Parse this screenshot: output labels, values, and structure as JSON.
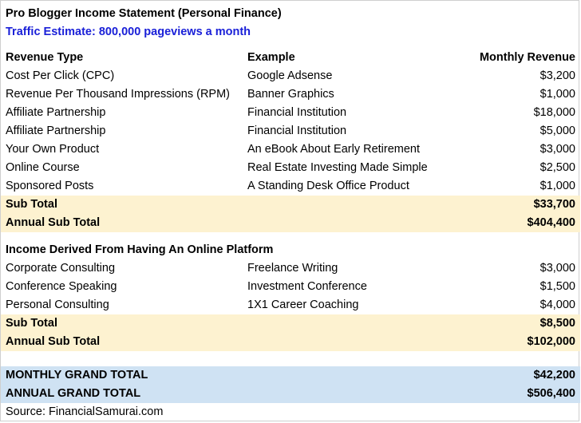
{
  "title": "Pro Blogger Income Statement (Personal Finance)",
  "subtitle": "Traffic Estimate: 800,000 pageviews a month",
  "headers": {
    "type": "Revenue Type",
    "example": "Example",
    "revenue": "Monthly Revenue"
  },
  "revenue_rows": [
    {
      "type": "Cost Per Click (CPC)",
      "example": "Google Adsense",
      "revenue": "$3,200"
    },
    {
      "type": "Revenue Per Thousand Impressions (RPM)",
      "example": "Banner Graphics",
      "revenue": "$1,000"
    },
    {
      "type": "Affiliate Partnership",
      "example": "Financial Institution",
      "revenue": "$18,000"
    },
    {
      "type": "Affiliate Partnership",
      "example": "Financial Institution",
      "revenue": "$5,000"
    },
    {
      "type": "Your Own Product",
      "example": "An eBook About Early Retirement",
      "revenue": "$3,000"
    },
    {
      "type": "Online Course",
      "example": "Real Estate Investing Made Simple",
      "revenue": "$2,500"
    },
    {
      "type": "Sponsored Posts",
      "example": "A Standing Desk Office Product",
      "revenue": "$1,000"
    }
  ],
  "subtotal1": {
    "label": "Sub Total",
    "value": "$33,700"
  },
  "annual_subtotal1": {
    "label": "Annual Sub Total",
    "value": "$404,400"
  },
  "section2_title": "Income Derived From Having An Online Platform",
  "platform_rows": [
    {
      "type": "Corporate Consulting",
      "example": "Freelance Writing",
      "revenue": "$3,000"
    },
    {
      "type": "Conference Speaking",
      "example": "Investment Conference",
      "revenue": "$1,500"
    },
    {
      "type": "Personal Consulting",
      "example": "1X1 Career Coaching",
      "revenue": "$4,000"
    }
  ],
  "subtotal2": {
    "label": "Sub Total",
    "value": "$8,500"
  },
  "annual_subtotal2": {
    "label": "Annual Sub Total",
    "value": "$102,000"
  },
  "monthly_grand_total": {
    "label": "MONTHLY GRAND TOTAL",
    "value": "$42,200"
  },
  "annual_grand_total": {
    "label": "ANNUAL GRAND TOTAL",
    "value": "$506,400"
  },
  "source": "Source: FinancialSamurai.com",
  "colors": {
    "subtitle": "#1a20d8",
    "subtotal_fill": "#fdf2d0",
    "grand_total_fill": "#cfe2f3"
  }
}
